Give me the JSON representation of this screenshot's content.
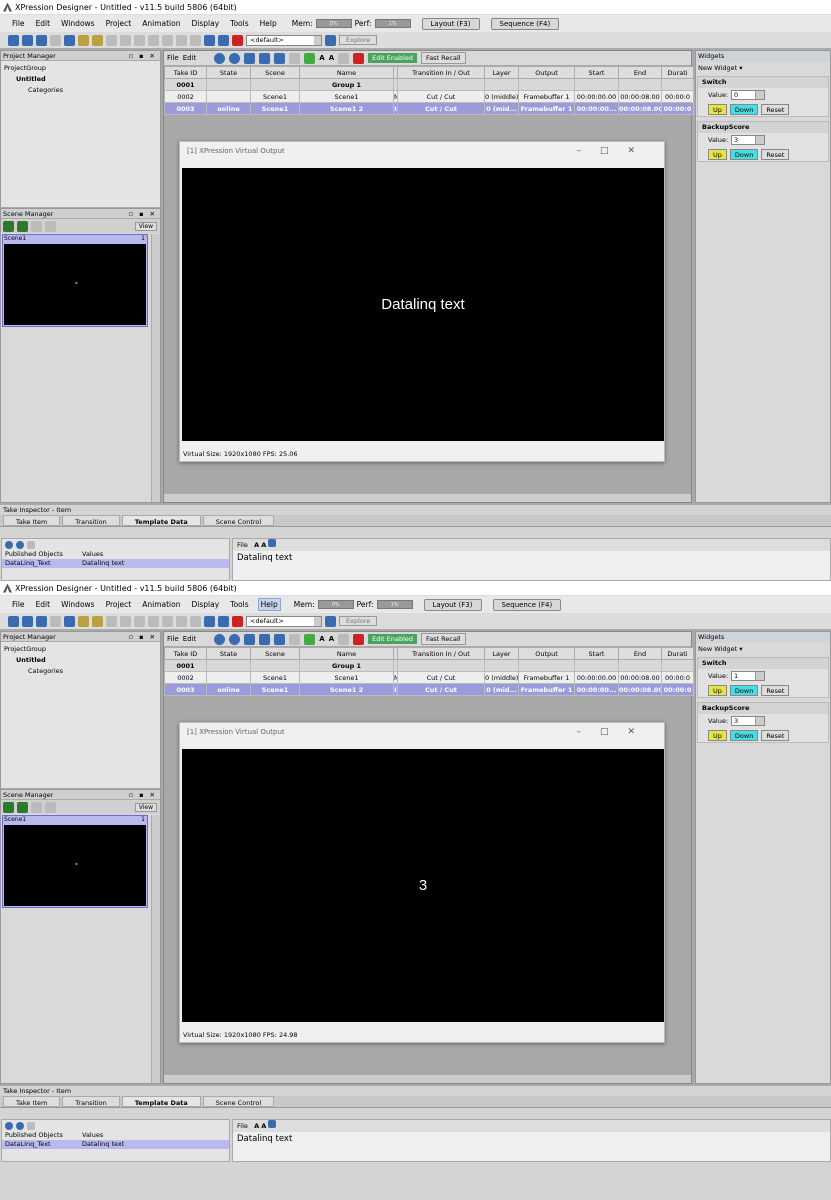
{
  "window": {
    "title": "XPression Designer - Untitled - v11.5 build 5806 (64bit)"
  },
  "menu": [
    "File",
    "Edit",
    "Windows",
    "Project",
    "Animation",
    "Display",
    "Tools",
    "Help"
  ],
  "meters": {
    "mem_label": "Mem:",
    "mem_value": "0%",
    "perf_label": "Perf:",
    "perf_value": "1%"
  },
  "layout_btn": "Layout (F3)",
  "sequence_btn": "Sequence (F4)",
  "toolbar": {
    "dropdown": "<default>",
    "explore": "Explore"
  },
  "project_manager": {
    "title": "Project Manager",
    "tree": [
      "ProjectGroup",
      "Untitled",
      "Categories"
    ]
  },
  "scene_manager": {
    "title": "Scene Manager",
    "view": "View",
    "scene_name": "Scene1",
    "scene_num": "1"
  },
  "sequencer": {
    "menu": [
      "File",
      "Edit"
    ],
    "edit_enabled": "Edit Enabled",
    "fast_recall": "Fast Recall",
    "columns": [
      "Take ID",
      "State",
      "Scene",
      "Name",
      "",
      "Transition In / Out",
      "Layer",
      "Output",
      "Start",
      "End",
      "Durati"
    ],
    "rows": [
      {
        "id": "0001",
        "state": "",
        "scene": "",
        "name": "Group 1",
        "m": "",
        "trans": "",
        "layer": "",
        "output": "",
        "start": "",
        "end": "",
        "dur": ""
      },
      {
        "id": "0002",
        "state": "",
        "scene": "Scene1",
        "name": "Scene1",
        "m": "M",
        "trans": "Cut / Cut",
        "layer": "0 (middle)",
        "output": "Framebuffer 1",
        "start": "00:00:00.00",
        "end": "00:00:08.00",
        "dur": "00:00:0"
      },
      {
        "id": "0003",
        "state": "online",
        "scene": "Scene1",
        "name": "Scene1 2",
        "m": "I",
        "trans": "Cut / Cut",
        "layer": "0 (mid...",
        "output": "Framebuffer 1",
        "start": "00:00:00...",
        "end": "00:00:08.00",
        "dur": "00:00:0"
      }
    ]
  },
  "virtual_output": {
    "title": "[1] XPression Virtual Output"
  },
  "widgets": {
    "title": "Widgets",
    "new_widget": "New Widget",
    "value_label": "Value:",
    "up": "Up",
    "down": "Down",
    "reset": "Reset",
    "groups": [
      {
        "name": "Switch"
      },
      {
        "name": "BackupScore"
      }
    ]
  },
  "inspector": {
    "title": "Take Inspector - Item",
    "tabs": [
      "Take Item",
      "Transition",
      "Template Data",
      "Scene Control"
    ],
    "col_published": "Published Objects",
    "col_values": "Values",
    "object_name": "DataLinq_Text",
    "object_value": "Datalinq text",
    "file": "File",
    "editor_text": "Datalinq text"
  },
  "shots": [
    {
      "switch_value": "0",
      "backup_value": "3",
      "output_text": "Datalinq text",
      "status": "Virtual Size: 1920x1080  FPS: 25.06"
    },
    {
      "switch_value": "1",
      "backup_value": "3",
      "output_text": "3",
      "status": "Virtual Size: 1920x1080  FPS: 24.98"
    }
  ]
}
